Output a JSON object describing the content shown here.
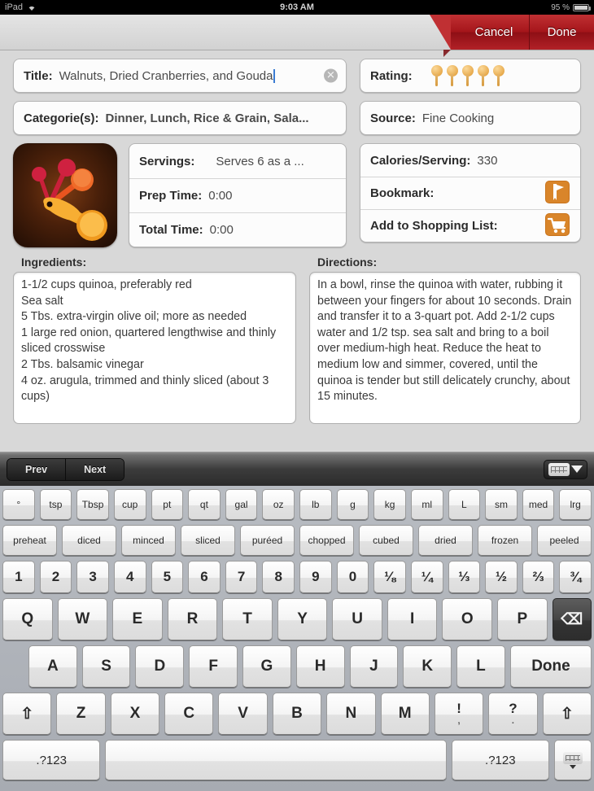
{
  "status_bar": {
    "carrier": "iPad",
    "wifi_icon": "wifi-icon",
    "time": "9:03 AM",
    "battery_percent": "95 %"
  },
  "topbar": {
    "cancel_label": "Cancel",
    "done_label": "Done"
  },
  "recipe": {
    "title_label": "Title:",
    "title_value": "Walnuts, Dried Cranberries, and Gouda",
    "clear_icon": "✕",
    "categories_label": "Categorie(s):",
    "categories_value": "Dinner, Lunch, Rice & Grain, Sala...",
    "rating_label": "Rating:",
    "rating_value": 5,
    "source_label": "Source:",
    "source_value": "Fine Cooking",
    "servings_label": "Servings:",
    "servings_value": "Serves 6 as a ...",
    "prep_time_label": "Prep Time:",
    "prep_time_value": "0:00",
    "total_time_label": "Total Time:",
    "total_time_value": "0:00",
    "calories_label": "Calories/Serving:",
    "calories_value": "330",
    "bookmark_label": "Bookmark:",
    "bookmark_icon": "bookmark-icon",
    "shopping_label": "Add to Shopping List:",
    "shopping_icon": "shopping-cart-icon",
    "app_icon": "measuring-spoons-icon",
    "ingredients_label": "Ingredients:",
    "ingredients_text": "1-1/2 cups quinoa, preferably red\nSea salt\n5 Tbs. extra-virgin olive oil; more as needed\n1 large red onion, quartered lengthwise and thinly sliced crosswise\n2 Tbs. balsamic vinegar\n4 oz. arugula, trimmed and thinly sliced (about 3 cups)",
    "directions_label": "Directions:",
    "directions_text": "In a bowl, rinse the quinoa with water, rubbing it between your fingers for about 10 seconds. Drain and transfer it to a 3-quart pot. Add 2-1/2 cups water and 1/2 tsp. sea salt and bring to a boil over medium-high heat. Reduce the heat to medium low and simmer, covered, until the quinoa is tender but still delicately crunchy, about 15 minutes."
  },
  "keyboard": {
    "prev_label": "Prev",
    "next_label": "Next",
    "hide_icon": "hide-keyboard-icon",
    "units_row": [
      "°",
      "tsp",
      "Tbsp",
      "cup",
      "pt",
      "qt",
      "gal",
      "oz",
      "lb",
      "g",
      "kg",
      "ml",
      "L",
      "sm",
      "med",
      "lrg"
    ],
    "verbs_row": [
      "preheat",
      "diced",
      "minced",
      "sliced",
      "puréed",
      "chopped",
      "cubed",
      "dried",
      "frozen",
      "peeled"
    ],
    "numbers_row": [
      "1",
      "2",
      "3",
      "4",
      "5",
      "6",
      "7",
      "8",
      "9",
      "0",
      "⅛",
      "¼",
      "⅓",
      "½",
      "⅔",
      "¾"
    ],
    "qwerty_row": [
      "Q",
      "W",
      "E",
      "R",
      "T",
      "Y",
      "U",
      "I",
      "O",
      "P"
    ],
    "backspace_label": "⌫",
    "asdf_row": [
      "A",
      "S",
      "D",
      "F",
      "G",
      "H",
      "J",
      "K",
      "L"
    ],
    "done_key_label": "Done",
    "zxcv_row": [
      "Z",
      "X",
      "C",
      "V",
      "B",
      "N",
      "M"
    ],
    "punct_keys": [
      {
        "top": "!",
        "bot": ","
      },
      {
        "top": "?",
        "bot": "."
      }
    ],
    "shift_label": "⇧",
    "numeric_key_label": ".?123",
    "space_label": ""
  },
  "colors": {
    "ribbon_red": "#a6161b",
    "accent_orange": "#d79b3f",
    "caret_blue": "#3b7cd3"
  }
}
